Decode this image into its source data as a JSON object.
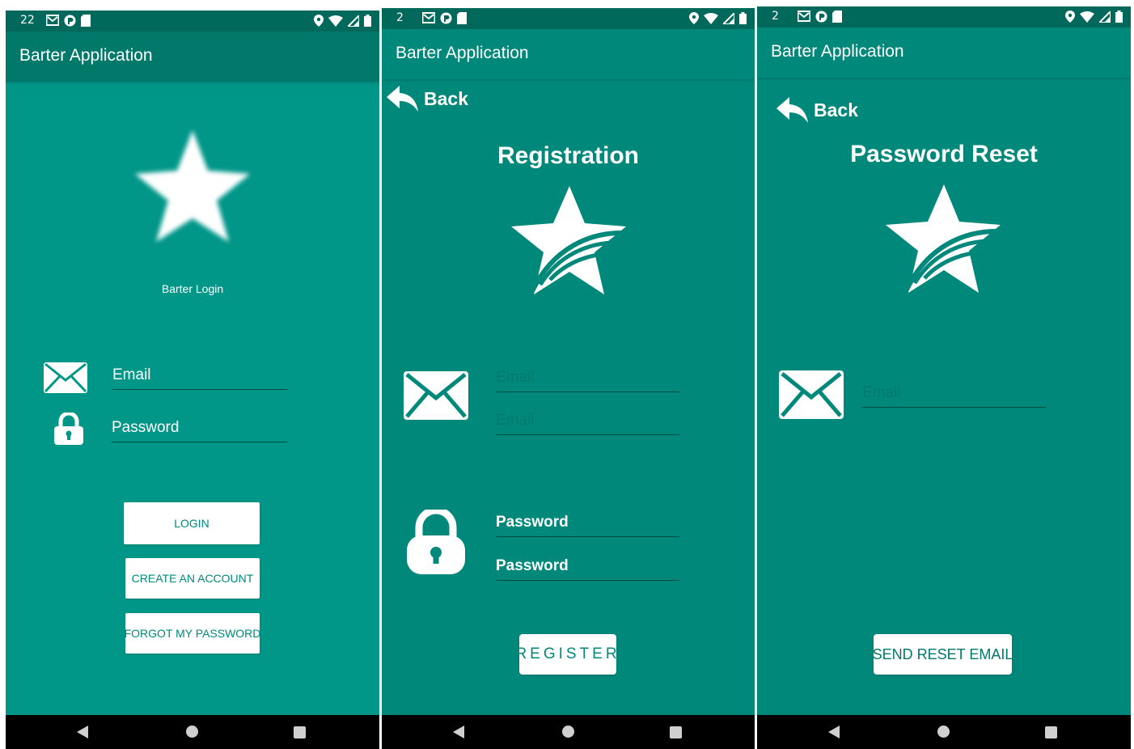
{
  "app": {
    "title": "Barter Application"
  },
  "login": {
    "status_time": "22",
    "heading": "Barter Login",
    "email_label": "Email",
    "password_label": "Password",
    "login_button": "LOGIN",
    "create_button": "CREATE AN ACCOUNT",
    "forgot_button": "FORGOT MY PASSWORD"
  },
  "registration": {
    "status_time": "2",
    "back_label": "Back",
    "heading": "Registration",
    "email_placeholder": "Email",
    "email_confirm_placeholder": "Email",
    "password_label": "Password",
    "password_confirm_label": "Password",
    "register_button": "REGISTER"
  },
  "reset": {
    "status_time": "2",
    "back_label": "Back",
    "heading": "Password Reset",
    "email_placeholder": "Email",
    "send_button": "SEND RESET EMAIL"
  },
  "colors": {
    "primary": "#009688",
    "primary_dark": "#00695c",
    "teal_mid": "#00897b",
    "field_line": "#004d40"
  },
  "icons": [
    "gmail-icon",
    "app-notification-icon",
    "sd-card-icon",
    "location-icon",
    "wifi-icon",
    "signal-icon",
    "battery-icon",
    "star-icon",
    "envelope-icon",
    "lock-icon",
    "back-arrow-icon"
  ]
}
